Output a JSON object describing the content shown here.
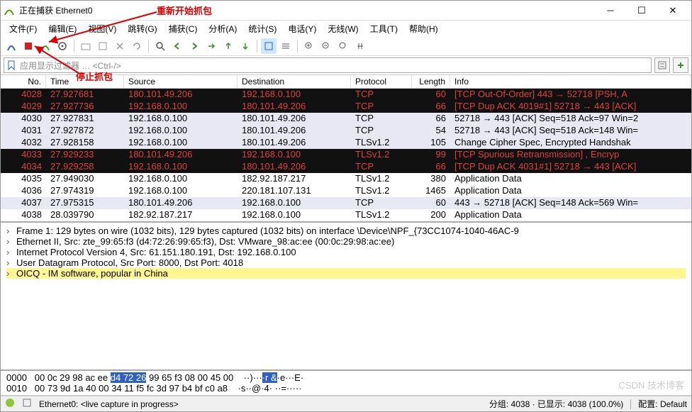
{
  "window": {
    "title": "正在捕获 Ethernet0"
  },
  "annotations": {
    "restart": "重新开始抓包",
    "stop": "停止抓包"
  },
  "menu": {
    "file": "文件(F)",
    "edit": "编辑(E)",
    "view": "视图(V)",
    "go": "跳转(G)",
    "capture": "捕获(C)",
    "analyze": "分析(A)",
    "stats": "统计(S)",
    "telephony": "电话(Y)",
    "wireless": "无线(W)",
    "tools": "工具(T)",
    "help": "帮助(H)"
  },
  "filter": {
    "placeholder": "应用显示过滤器 … <Ctrl-/>"
  },
  "columns": {
    "no": "No.",
    "time": "Time",
    "src": "Source",
    "dst": "Destination",
    "proto": "Protocol",
    "len": "Length",
    "info": "Info"
  },
  "packets": [
    {
      "no": "4028",
      "time": "27.927681",
      "src": "180.101.49.206",
      "dst": "192.168.0.100",
      "proto": "TCP",
      "len": "60",
      "info": "[TCP Out-Of-Order] 443 → 52718 [PSH, A",
      "cls": "row-black"
    },
    {
      "no": "4029",
      "time": "27.927736",
      "src": "192.168.0.100",
      "dst": "180.101.49.206",
      "proto": "TCP",
      "len": "66",
      "info": "[TCP Dup ACK 4019#1] 52718 → 443 [ACK]",
      "cls": "row-black"
    },
    {
      "no": "4030",
      "time": "27.927831",
      "src": "192.168.0.100",
      "dst": "180.101.49.206",
      "proto": "TCP",
      "len": "66",
      "info": "52718 → 443 [ACK] Seq=518 Ack=97 Win=2",
      "cls": "row-alt"
    },
    {
      "no": "4031",
      "time": "27.927872",
      "src": "192.168.0.100",
      "dst": "180.101.49.206",
      "proto": "TCP",
      "len": "54",
      "info": "52718 → 443 [ACK] Seq=518 Ack=148 Win=",
      "cls": "row-alt"
    },
    {
      "no": "4032",
      "time": "27.928158",
      "src": "192.168.0.100",
      "dst": "180.101.49.206",
      "proto": "TLSv1.2",
      "len": "105",
      "info": "Change Cipher Spec, Encrypted Handshak",
      "cls": "row-alt"
    },
    {
      "no": "4033",
      "time": "27.929233",
      "src": "180.101.49.206",
      "dst": "192.168.0.100",
      "proto": "TLSv1.2",
      "len": "99",
      "info": "[TCP Spurious Retransmission] , Encryp",
      "cls": "row-black"
    },
    {
      "no": "4034",
      "time": "27.929258",
      "src": "192.168.0.100",
      "dst": "180.101.49.206",
      "proto": "TCP",
      "len": "66",
      "info": "[TCP Dup ACK 4031#1] 52718 → 443 [ACK]",
      "cls": "row-black"
    },
    {
      "no": "4035",
      "time": "27.949030",
      "src": "192.168.0.100",
      "dst": "182.92.187.217",
      "proto": "TLSv1.2",
      "len": "380",
      "info": "Application Data",
      "cls": "row-normal"
    },
    {
      "no": "4036",
      "time": "27.974319",
      "src": "192.168.0.100",
      "dst": "220.181.107.131",
      "proto": "TLSv1.2",
      "len": "1465",
      "info": "Application Data",
      "cls": "row-normal"
    },
    {
      "no": "4037",
      "time": "27.975315",
      "src": "180.101.49.206",
      "dst": "192.168.0.100",
      "proto": "TCP",
      "len": "60",
      "info": "443 → 52718 [ACK] Seq=148 Ack=569 Win=",
      "cls": "row-alt"
    },
    {
      "no": "4038",
      "time": "28.039790",
      "src": "182.92.187.217",
      "dst": "192.168.0.100",
      "proto": "TLSv1.2",
      "len": "200",
      "info": "Application Data",
      "cls": "row-normal"
    }
  ],
  "detail": {
    "frame": "Frame 1: 129 bytes on wire (1032 bits), 129 bytes captured (1032 bits) on interface \\Device\\NPF_{73CC1074-1040-46AC-9",
    "eth": "Ethernet II, Src: zte_99:65:f3 (d4:72:26:99:65:f3), Dst: VMware_98:ac:ee (00:0c:29:98:ac:ee)",
    "ip": "Internet Protocol Version 4, Src: 61.151.180.191, Dst: 192.168.0.100",
    "udp": "User Datagram Protocol, Src Port: 8000, Dst Port: 4018",
    "oicq": "OICQ - IM software, popular in China"
  },
  "hex": {
    "line0_off": "0000",
    "line0_hex_a": "00 0c 29 98 ac ee ",
    "line0_hex_sel": "d4 72  26",
    "line0_hex_b": " 99 65 f3 08 00 45 00",
    "line0_ascii_a": "··)···",
    "line0_ascii_sel": "·r &",
    "line0_ascii_b": "·e···E·",
    "line1_off": "0010",
    "line1_hex": "00 73 9d 1a 40 00 34 11  f5 fc 3d 97 b4 bf c0 a8",
    "line1_ascii": "·s··@·4· ··=·····"
  },
  "status": {
    "iface": "Ethernet0: <live capture in progress>",
    "packets": "分组: 4038 · 已显示: 4038 (100.0%)",
    "profile": "配置: Default"
  },
  "watermark": "CSDN 技术博客"
}
